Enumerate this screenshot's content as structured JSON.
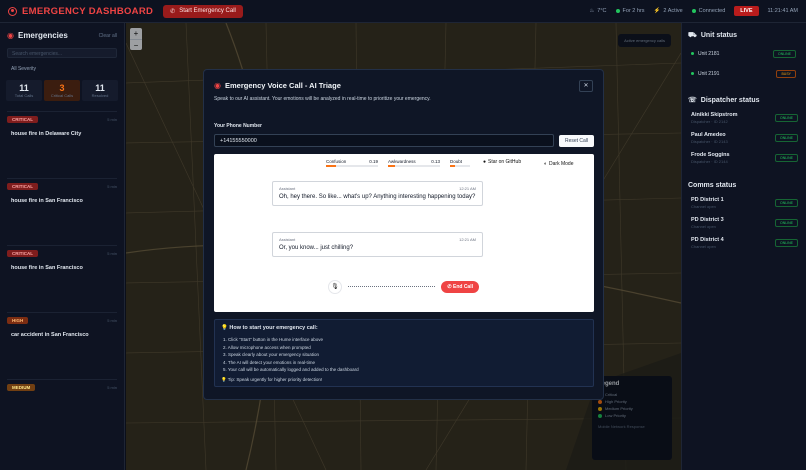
{
  "header": {
    "title": "EMERGENCY DASHBOARD",
    "call_button": "Start Emergency Call",
    "stats": [
      "7°C",
      "For 2 hrs",
      "2 Active",
      "Connected"
    ],
    "live": "LIVE",
    "time": "11:21:41 AM"
  },
  "left": {
    "title": "Emergencies",
    "clear": "Clear all",
    "search_placeholder": "Search emergencies...",
    "filter": "All Severity",
    "counts": [
      {
        "n": "11",
        "l": "Total Calls"
      },
      {
        "n": "3",
        "l": "Critical Calls"
      },
      {
        "n": "11",
        "l": "Resolved"
      }
    ],
    "incidents": [
      {
        "severity": "CRITICAL",
        "time": "5 min",
        "title": "house fire in Delaware City"
      },
      {
        "severity": "CRITICAL",
        "time": "5 min",
        "title": "house fire in San Francisco"
      },
      {
        "severity": "CRITICAL",
        "time": "5 min",
        "title": "house fire in San Francisco"
      },
      {
        "severity": "HIGH",
        "time": "5 min",
        "title": "car accident in San Francisco"
      },
      {
        "severity": "MEDIUM",
        "time": "5 min",
        "title": ""
      }
    ]
  },
  "map": {
    "zoom_in": "+",
    "zoom_out": "−",
    "pill": "Active emergency calls",
    "legend": {
      "title": "Legend",
      "items": [
        "Critical",
        "High Priority",
        "Medium Priority",
        "Low Priority"
      ],
      "colors": [
        "#ef4444",
        "#f97316",
        "#eab308",
        "#22c55e"
      ],
      "footer": "Mobile Network Response"
    }
  },
  "right": {
    "unit_title": "Unit status",
    "units": [
      {
        "name": "Unit 2181",
        "status": "ONLINE"
      },
      {
        "name": "Unit 2191",
        "status": "BUSY"
      }
    ],
    "dispatch_title": "Dispatcher status",
    "dispatchers": [
      {
        "name": "Ainikki Skipstrom",
        "meta": "Dispatcher · ID 2142",
        "status": "ONLINE"
      },
      {
        "name": "Paul Amedeo",
        "meta": "Dispatcher · ID 2143",
        "status": "ONLINE"
      },
      {
        "name": "Frode Soggins",
        "meta": "Dispatcher · ID 2144",
        "status": "ONLINE"
      }
    ],
    "comms_title": "Comms status",
    "comms": [
      {
        "name": "PD District 1",
        "meta": "Channel open",
        "status": "ONLINE"
      },
      {
        "name": "PD District 3",
        "meta": "Channel open",
        "status": "ONLINE"
      },
      {
        "name": "PD District 4",
        "meta": "Channel open",
        "status": "ONLINE"
      }
    ]
  },
  "modal": {
    "title": "Emergency Voice Call - AI Triage",
    "subtitle": "Speak to our AI assistant. Your emotions will be analyzed in real-time to prioritize your emergency.",
    "phone_label": "Your Phone Number",
    "phone_value": "+14155550000",
    "reset": "Reset Call",
    "close": "✕",
    "emotions": [
      {
        "name": "Confusion",
        "value": "0.19",
        "level": 0.19
      },
      {
        "name": "Awkwardness",
        "value": "0.13",
        "level": 0.13
      },
      {
        "name": "Doubt",
        "value": "",
        "level": 0.1
      }
    ],
    "github": "Star on GitHub",
    "darkmode": "Dark Mode",
    "messages": [
      {
        "role": "Assistant",
        "time": "12:21 AM",
        "text": "Oh, hey there. So like... what's up? Anything interesting happening today?"
      },
      {
        "role": "Assistant",
        "time": "12:21 AM",
        "text": "Or, you know... just chilling?"
      }
    ],
    "end_call": "End Call",
    "howto_title": "How to start your emergency call:",
    "steps": [
      "1. Click \"Start\" button in the Hume interface above",
      "2. Allow microphone access when prompted",
      "3. Speak clearly about your emergency situation",
      "4. The AI will detect your emotions in real-time",
      "5. Your call will be automatically logged and added to the dashboard"
    ],
    "tip": "Tip: Speak urgently for higher priority detection!"
  }
}
